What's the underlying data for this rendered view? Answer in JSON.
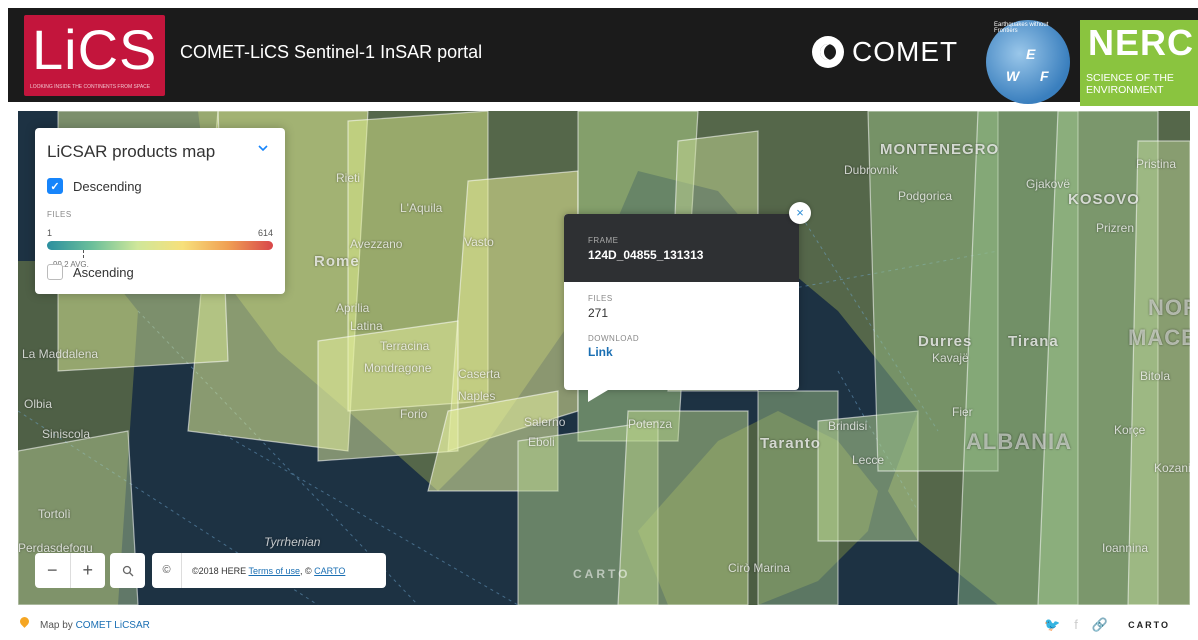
{
  "header": {
    "logo_text": "LiCS",
    "logo_tagline": "LOOKING INSIDE THE CONTINENTS FROM SPACE",
    "title": "COMET-LiCS Sentinel-1 InSAR portal",
    "comet_label": "COMET",
    "ewf_text": "Earthquakes without Frontiers",
    "ewf_letters": [
      "E",
      "W",
      "F"
    ],
    "nerc_title": "NERC",
    "nerc_subtitle_1": "SCIENCE OF THE",
    "nerc_subtitle_2": "ENVIRONMENT"
  },
  "legend": {
    "title": "LiCSAR products map",
    "descending_label": "Descending",
    "descending_checked": true,
    "files_label": "FILES",
    "min": "1",
    "max": "614",
    "avg_label": "99.2 AVG.",
    "ascending_label": "Ascending",
    "ascending_checked": false
  },
  "popup": {
    "frame_label": "FRAME",
    "frame_value": "124D_04855_131313",
    "files_label": "FILES",
    "files_value": "271",
    "download_label": "DOWNLOAD",
    "download_link": "Link",
    "close_icon": "×"
  },
  "controls": {
    "zoom_out": "−",
    "zoom_in": "+",
    "copyright_icon": "©",
    "attribution_prefix": "©2018 HERE ",
    "terms_link": "Terms of use",
    "attribution_mid": ", © ",
    "carto_link": "CARTO",
    "watermark": "CARTO"
  },
  "map_labels": {
    "montenegro": "MONTENEGRO",
    "kosovo": "KOSOVO",
    "albania": "ALBANIA",
    "nor": "NOR",
    "maced": "MACED",
    "rome": "Rome",
    "laquila": "L'Aquila",
    "avezzano": "Avezzano",
    "latina": "Latina",
    "terracina": "Terracina",
    "mondragone": "Mondragone",
    "caserta": "Caserta",
    "naples": "Naples",
    "salerno": "Salerno",
    "eboli": "Eboli",
    "potenza": "Potenza",
    "taranto": "Taranto",
    "brindisi": "Brindisi",
    "lecce": "Lecce",
    "durres": "Durres",
    "kavaje": "Kavajë",
    "tirana": "Tirana",
    "podgorica": "Podgorica",
    "dubrovnik": "Dubrovnik",
    "pristina": "Pristina",
    "gjakove": "Gjakovë",
    "prizren": "Prizren",
    "bitola": "Bitola",
    "korce": "Korçe",
    "fier": "Fier",
    "olbia": "Olbia",
    "siniscola": "Siniscola",
    "tortoli": "Tortolì",
    "perdasdefogu": "Perdasdefogu",
    "la_maddalena": "La Maddalena",
    "tyrrhenian": "Tyrrhenian",
    "ciro_marina": "Cirò Marina",
    "vasto": "Vasto",
    "rieti": "Rieti",
    "forio": "Forio",
    "aprilia": "Aprilia",
    "ioannina": "Ioannina",
    "kozani": "Kozani"
  },
  "footer": {
    "map_by": "Map by ",
    "map_by_link": "COMET LiCSAR",
    "carto": "CARTO"
  },
  "colors": {
    "header_bg": "#1b1b1b",
    "lics_red": "#c3153c",
    "nerc_green": "#8ac43f",
    "accent_blue": "#1785fb"
  }
}
